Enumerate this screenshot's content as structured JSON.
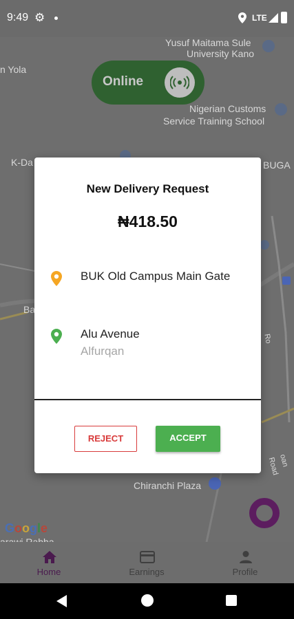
{
  "status_bar": {
    "time": "9:49",
    "network": "LTE"
  },
  "map": {
    "labels": [
      "Yusuf Maitama Sule",
      "University Kano",
      "n Yola",
      "Nigerian Customs",
      "Service Training School",
      "K-Da",
      "BUGA",
      "Ba",
      "Chiranchi Plaza",
      "arawi Rabba",
      "Ro",
      "oan Road"
    ],
    "google_logo": [
      "G",
      "o",
      "o",
      "g",
      "l",
      "e"
    ]
  },
  "online_toggle": {
    "label": "Online"
  },
  "dialog": {
    "title": "New Delivery Request",
    "amount": "₦418.50",
    "pickup": {
      "name": "BUK Old Campus Main Gate",
      "pin_color": "#f5a623"
    },
    "dropoff": {
      "name": "Alu Avenue",
      "subtitle": "Alfurqan",
      "pin_color": "#4caf50"
    },
    "reject_label": "REJECT",
    "accept_label": "ACCEPT"
  },
  "bottom_nav": {
    "items": [
      {
        "label": "Home",
        "icon": "home-icon",
        "active": true
      },
      {
        "label": "Earnings",
        "icon": "card-icon",
        "active": false
      },
      {
        "label": "Profile",
        "icon": "person-icon",
        "active": false
      }
    ]
  },
  "colors": {
    "accent": "#4caf50",
    "danger": "#d83a3a",
    "brand": "#4a1a4e"
  }
}
